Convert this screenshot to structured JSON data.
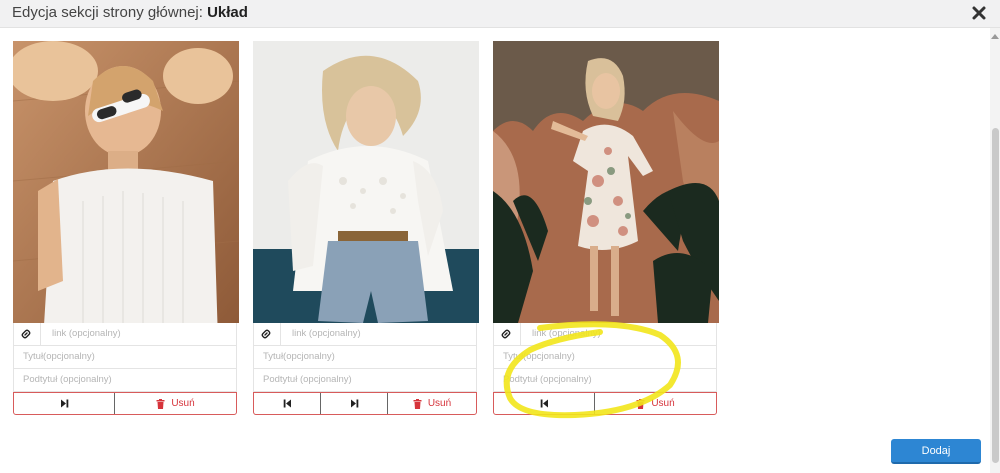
{
  "dialog": {
    "title_prefix": "Edycja sekcji strony głównej:",
    "title_bold": "Układ",
    "close_icon": "close-x-icon"
  },
  "cards": [
    {
      "link_placeholder": "link (opcjonalny)",
      "title_placeholder": "Tytuł(opcjonalny)",
      "subtitle_placeholder": "Podtytuł (opcjonalny)",
      "delete_label": "Usuń"
    },
    {
      "link_placeholder": "link (opcjonalny)",
      "title_placeholder": "Tytuł(opcjonalny)",
      "subtitle_placeholder": "Podtytuł (opcjonalny)",
      "delete_label": "Usuń"
    },
    {
      "link_placeholder": "link (opcjonalny)",
      "title_placeholder": "Tytuł(opcjonalny)",
      "subtitle_placeholder": "Podtytuł (opcjonalny)",
      "delete_label": "Usuń"
    }
  ],
  "footer": {
    "add_label": "Dodaj"
  },
  "colors": {
    "accent": "#2d86d3",
    "danger": "#d6343b",
    "highlight": "#f2e51b"
  }
}
